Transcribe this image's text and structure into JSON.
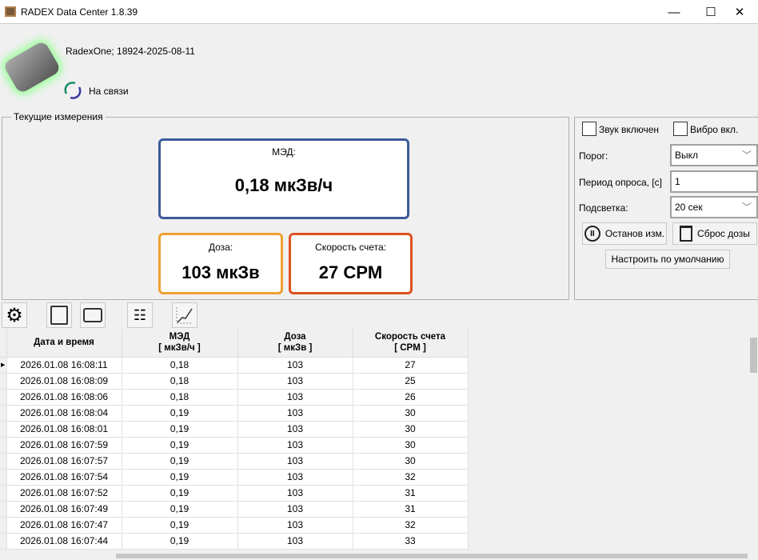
{
  "window": {
    "title": "RADEX Data Center 1.8.39"
  },
  "device": {
    "name": "RadexOne; 18924-2025-08-11",
    "status": "На связи"
  },
  "current": {
    "group_label": "Текущие измерения",
    "med_label": "МЭД:",
    "med_value": "0,18 мкЗв/ч",
    "dose_label": "Доза:",
    "dose_value": "103 мкЗв",
    "rate_label": "Скорость счета:",
    "rate_value": "27 CPM",
    "colors": {
      "med": "#3c5a9a",
      "dose": "#f0a030",
      "rate": "#e05020"
    }
  },
  "settings": {
    "sound_label": "Звук включен",
    "vibro_label": "Вибро вкл.",
    "threshold_label": "Порог:",
    "threshold_value": "Выкл",
    "period_label": "Период опроса, [с]",
    "period_value": "1",
    "backlight_label": "Подсветка:",
    "backlight_value": "20 сек",
    "stop_label": "Останов изм.",
    "reset_label": "Сброс дозы",
    "default_label": "Настроить по умолчанию"
  },
  "table": {
    "headers": [
      [
        "Дата и время",
        ""
      ],
      [
        "МЭД",
        "[ мкЗв/ч ]"
      ],
      [
        "Доза",
        "[ мкЗв ]"
      ],
      [
        "Скорость счета",
        "[ CPM ]"
      ]
    ],
    "rows": [
      [
        "2026.01.08 16:08:11",
        "0,18",
        "103",
        "27"
      ],
      [
        "2026.01.08 16:08:09",
        "0,18",
        "103",
        "25"
      ],
      [
        "2026.01.08 16:08:06",
        "0,18",
        "103",
        "26"
      ],
      [
        "2026.01.08 16:08:04",
        "0,19",
        "103",
        "30"
      ],
      [
        "2026.01.08 16:08:01",
        "0,19",
        "103",
        "30"
      ],
      [
        "2026.01.08 16:07:59",
        "0,19",
        "103",
        "30"
      ],
      [
        "2026.01.08 16:07:57",
        "0,19",
        "103",
        "30"
      ],
      [
        "2026.01.08 16:07:54",
        "0,19",
        "103",
        "32"
      ],
      [
        "2026.01.08 16:07:52",
        "0,19",
        "103",
        "31"
      ],
      [
        "2026.01.08 16:07:49",
        "0,19",
        "103",
        "31"
      ],
      [
        "2026.01.08 16:07:47",
        "0,19",
        "103",
        "32"
      ],
      [
        "2026.01.08 16:07:44",
        "0,19",
        "103",
        "33"
      ]
    ]
  }
}
